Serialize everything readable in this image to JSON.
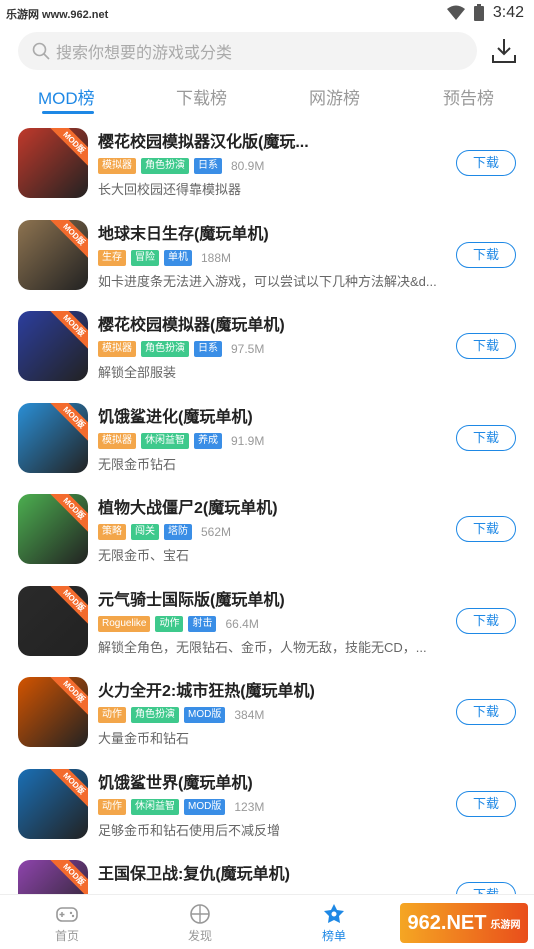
{
  "status": {
    "watermark_text": "乐游网 www.962.net",
    "time": "3:42"
  },
  "search": {
    "placeholder": "搜索你想要的游戏或分类"
  },
  "tabs": [
    {
      "label": "MOD榜",
      "active": true
    },
    {
      "label": "下载榜"
    },
    {
      "label": "网游榜"
    },
    {
      "label": "预告榜"
    }
  ],
  "ribbon_label": "MOD版",
  "button_label": "下载",
  "games": [
    {
      "title": "樱花校园模拟器汉化版(魔玩...",
      "tags": [
        [
          "模拟器",
          "#f3a64a"
        ],
        [
          "角色扮演",
          "#3ec98c"
        ],
        [
          "日系",
          "#3a8ee6"
        ]
      ],
      "size": "80.9M",
      "desc": "长大回校园还得靠模拟器"
    },
    {
      "title": "地球末日生存(魔玩单机)",
      "tags": [
        [
          "生存",
          "#f3a64a"
        ],
        [
          "冒险",
          "#3ec98c"
        ],
        [
          "单机",
          "#3a8ee6"
        ]
      ],
      "size": "188M",
      "desc": "如卡进度条无法进入游戏，可以尝试以下几种方法解决&d..."
    },
    {
      "title": "樱花校园模拟器(魔玩单机)",
      "tags": [
        [
          "模拟器",
          "#f3a64a"
        ],
        [
          "角色扮演",
          "#3ec98c"
        ],
        [
          "日系",
          "#3a8ee6"
        ]
      ],
      "size": "97.5M",
      "desc": "解锁全部服装"
    },
    {
      "title": "饥饿鲨进化(魔玩单机)",
      "tags": [
        [
          "模拟器",
          "#f3a64a"
        ],
        [
          "休闲益智",
          "#3ec98c"
        ],
        [
          "养成",
          "#3a8ee6"
        ]
      ],
      "size": "91.9M",
      "desc": "无限金币钻石"
    },
    {
      "title": "植物大战僵尸2(魔玩单机)",
      "tags": [
        [
          "策略",
          "#f3a64a"
        ],
        [
          "闯关",
          "#3ec98c"
        ],
        [
          "塔防",
          "#3a8ee6"
        ]
      ],
      "size": "562M",
      "desc": "无限金币、宝石"
    },
    {
      "title": "元气骑士国际版(魔玩单机)",
      "tags": [
        [
          "Roguelike",
          "#f3a64a"
        ],
        [
          "动作",
          "#3ec98c"
        ],
        [
          "射击",
          "#3a8ee6"
        ]
      ],
      "size": "66.4M",
      "desc": "解锁全角色，无限钻石、金币，人物无敌，技能无CD，..."
    },
    {
      "title": "火力全开2:城市狂热(魔玩单机)",
      "tags": [
        [
          "动作",
          "#f3a64a"
        ],
        [
          "角色扮演",
          "#3ec98c"
        ],
        [
          "MOD版",
          "#3a8ee6"
        ]
      ],
      "size": "384M",
      "desc": "大量金币和钻石"
    },
    {
      "title": "饥饿鲨世界(魔玩单机)",
      "tags": [
        [
          "动作",
          "#f3a64a"
        ],
        [
          "休闲益智",
          "#3ec98c"
        ],
        [
          "MOD版",
          "#3a8ee6"
        ]
      ],
      "size": "123M",
      "desc": "足够金币和钻石使用后不减反增"
    },
    {
      "title": "王国保卫战:复仇(魔玩单机)",
      "tags": [],
      "size": "",
      "desc": ""
    }
  ],
  "icon_colors": [
    "#c0392b",
    "#8d7350",
    "#2c3e9e",
    "#2a8fd6",
    "#4caf50",
    "#2a2a2a",
    "#d35400",
    "#1a6fb5",
    "#8e44ad"
  ],
  "nav": [
    {
      "label": "首页",
      "icon": "gamepad-icon"
    },
    {
      "label": "发现",
      "icon": "discover-icon"
    },
    {
      "label": "榜单",
      "icon": "rank-icon",
      "active": true
    }
  ],
  "watermark": {
    "main": "962.NET",
    "sub": "乐游网"
  }
}
